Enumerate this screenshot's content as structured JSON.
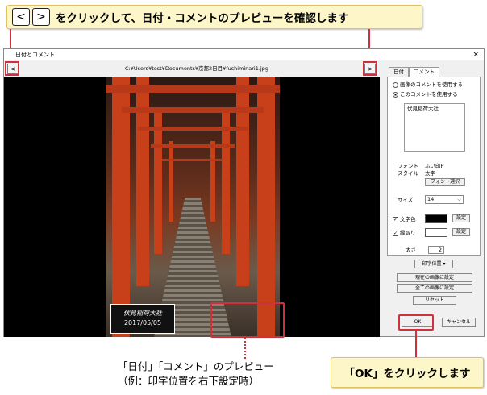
{
  "top_callout": {
    "key_left": "<",
    "key_right": ">",
    "text": "をクリックして、日付・コメントのプレビューを確認します"
  },
  "window": {
    "title": "日付とコメント",
    "close": "×",
    "prev_button": "<",
    "next_button": ">",
    "path": "C:¥Users¥test¥Documents¥京都2日目¥fushiminari1.jpg"
  },
  "preview": {
    "stamp_comment": "伏見稲荷大社",
    "stamp_date": "2017/05/05"
  },
  "panel": {
    "tabs": [
      "日付",
      "コメント"
    ],
    "radio_image_comment": "画像のコメントを使用する",
    "radio_this_comment": "このコメントを使用する",
    "comment_text": "伏見稲荷大社",
    "font_label": "フォント",
    "font_value": "ふい印P",
    "style_label": "スタイル",
    "style_value": "太字",
    "font_select_button": "フォント選択",
    "size_label": "サイズ",
    "size_value": "14",
    "text_color_label": "文字色",
    "border_label": "縁取り",
    "settings_button": "設定",
    "thickness_label": "太さ",
    "thickness_value": "2",
    "print_position_button": "印字位置",
    "set_current_button": "現在の画像に設定",
    "set_all_button": "全ての画像に設定",
    "reset_button": "リセット",
    "ok_button": "OK",
    "cancel_button": "キャンセル"
  },
  "bottom_label": {
    "line1": "「日付」「コメント」のプレビュー",
    "line2": "（例：印字位置を右下設定時）"
  },
  "ok_callout": {
    "text": "「OK」をクリックします"
  },
  "colors": {
    "accent_red": "#d0303a",
    "callout_bg": "#fdf6c8",
    "torii_orange": "#c8401a"
  }
}
